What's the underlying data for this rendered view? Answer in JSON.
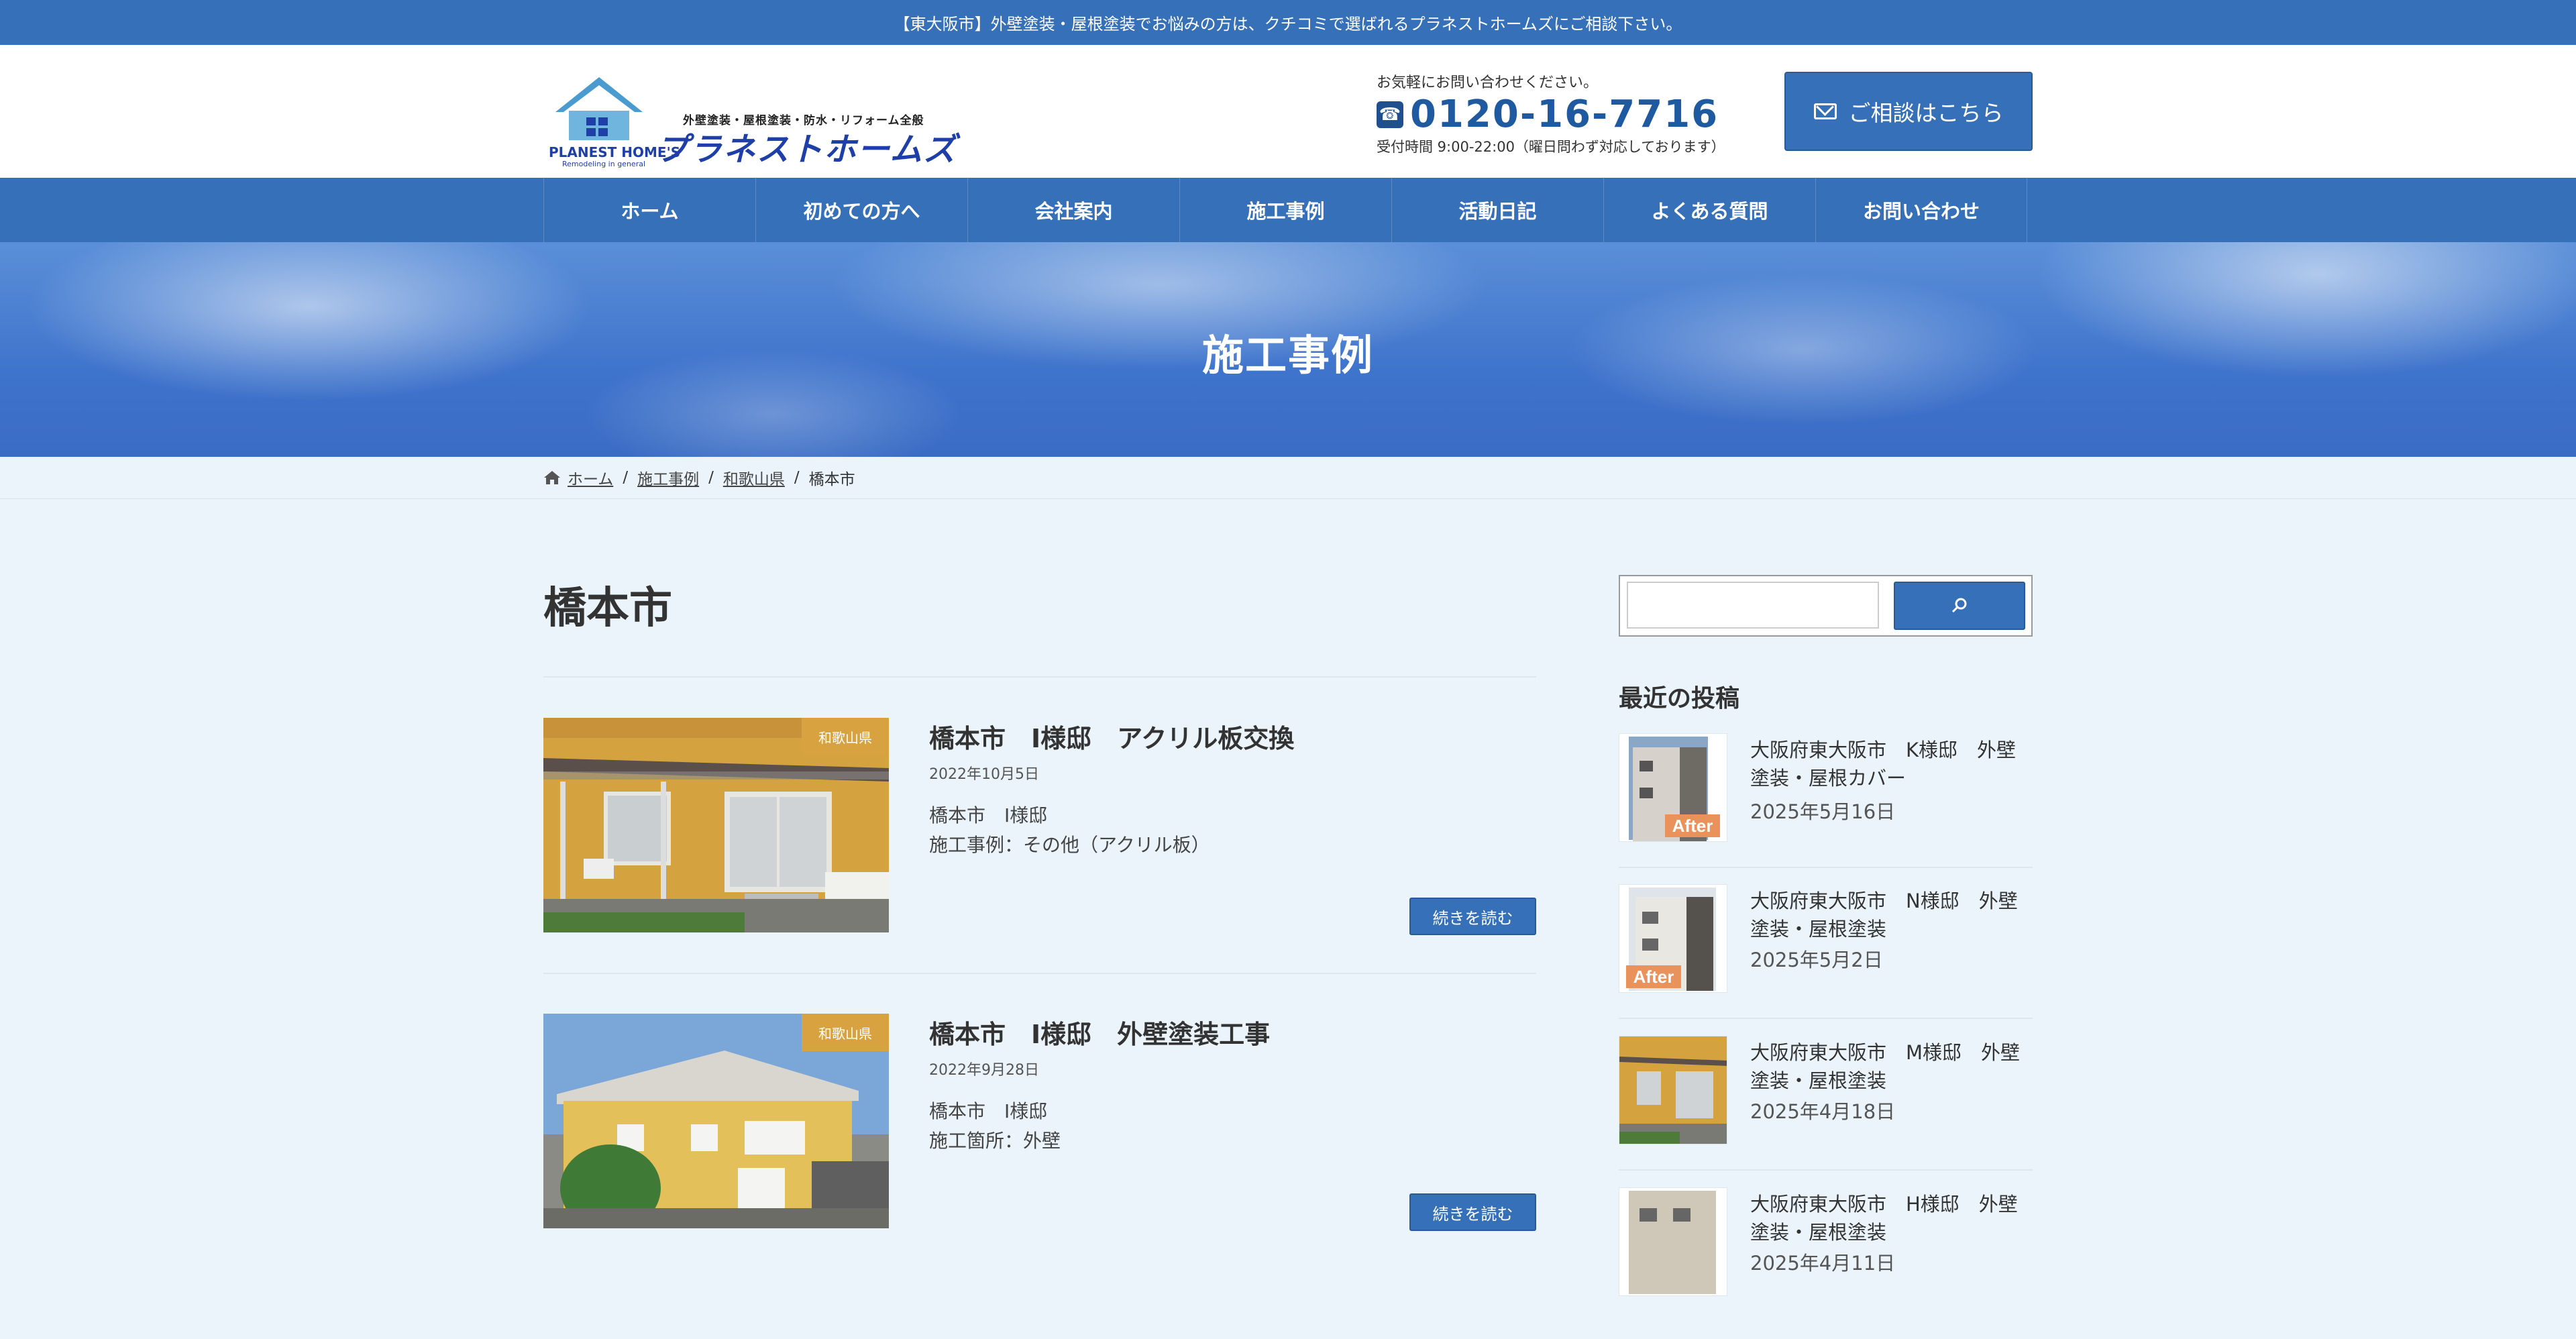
{
  "topbar": {
    "text": "【東大阪市】外壁塗装・屋根塗装でお悩みの方は、クチコミで選ばれるプラネストホームズにご相談下さい。"
  },
  "header": {
    "logo": {
      "subtitle": "外壁塗装・屋根塗装・防水・リフォーム全般",
      "name": "プラネストホームズ",
      "name_en": "PLANEST HOME'S",
      "tagline_en": "Remodeling in general"
    },
    "contact": {
      "lead": "お気軽にお問い合わせください。",
      "phone": "0120-16-7716",
      "hours": "受付時間 9:00-22:00（曜日問わず対応しております）"
    },
    "consult_button": "ご相談はこちら"
  },
  "nav": {
    "items": [
      {
        "label": "ホーム"
      },
      {
        "label": "初めての方へ"
      },
      {
        "label": "会社案内"
      },
      {
        "label": "施工事例"
      },
      {
        "label": "活動日記"
      },
      {
        "label": "よくある質問"
      },
      {
        "label": "お問い合わせ"
      }
    ]
  },
  "hero": {
    "title": "施工事例"
  },
  "breadcrumb": {
    "items": [
      {
        "label": "ホーム"
      },
      {
        "label": "施工事例"
      },
      {
        "label": "和歌山県"
      }
    ],
    "current": "橋本市",
    "separator": "/"
  },
  "main": {
    "page_title": "橋本市",
    "posts": [
      {
        "badge": "和歌山県",
        "title": "橋本市　I様邸　アクリル板交換",
        "date": "2022年10月5日",
        "line1": "橋本市　I様邸",
        "line2": "施工事例：その他（アクリル板）",
        "more": "続きを読む"
      },
      {
        "badge": "和歌山県",
        "title": "橋本市　I様邸　外壁塗装工事",
        "date": "2022年9月28日",
        "line1": "橋本市　I様邸",
        "line2": "施工箇所：外壁",
        "more": "続きを読む"
      }
    ]
  },
  "sidebar": {
    "search": {
      "placeholder": "",
      "icon": "search-icon"
    },
    "recent_heading": "最近の投稿",
    "recent": [
      {
        "title": "大阪府東大阪市　K様邸　外壁塗装・屋根カバー",
        "date": "2025年5月16日",
        "tag": "After"
      },
      {
        "title": "大阪府東大阪市　N様邸　外壁塗装・屋根塗装",
        "date": "2025年5月2日",
        "tag": "After"
      },
      {
        "title": "大阪府東大阪市　M様邸　外壁塗装・屋根塗装",
        "date": "2025年4月18日",
        "tag": ""
      },
      {
        "title": "大阪府東大阪市　H様邸　外壁塗装・屋根塗装",
        "date": "2025年4月11日",
        "tag": ""
      }
    ]
  },
  "colors": {
    "primary": "#3670b9",
    "accent_badge": "#d9a241",
    "background": "#eaf4fa",
    "after_tag": "#e9925b"
  }
}
